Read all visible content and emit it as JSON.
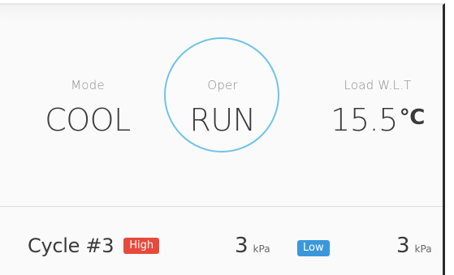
{
  "status": {
    "mode": {
      "label": "Mode",
      "value": "COOL"
    },
    "oper": {
      "label": "Oper",
      "value": "RUN"
    },
    "load": {
      "label": "Load W.L.T",
      "value": "15.5",
      "unit": "°C"
    }
  },
  "cycle": {
    "label": "Cycle #3",
    "high": {
      "badge": "High",
      "value": "3",
      "unit": "kPa",
      "color": "#e8493b"
    },
    "low": {
      "badge": "Low",
      "value": "3",
      "unit": "kPa",
      "color": "#3b97dc"
    }
  },
  "colors": {
    "ring": "#6fc4ea",
    "text": "#3a3a3a",
    "label": "#8c8c8c"
  }
}
